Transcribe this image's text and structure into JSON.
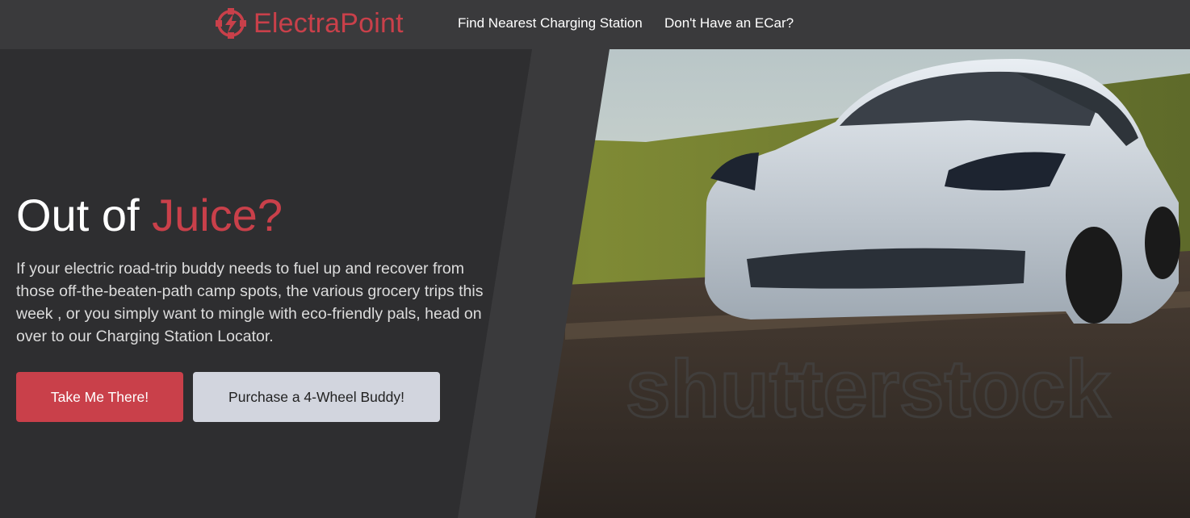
{
  "brand": {
    "name": "ElectraPoint",
    "color": "#c9404a",
    "icon": "lightning-bolt-icon"
  },
  "nav": {
    "links": [
      {
        "label": "Find Nearest Charging Station"
      },
      {
        "label": "Don't Have an ECar?"
      }
    ]
  },
  "hero": {
    "headline_plain": "Out of ",
    "headline_accent": "Juice?",
    "body": "If your electric road-trip buddy needs to fuel up and recover from those off-the-beaten-path camp spots, the various grocery trips this week , or you simply want to mingle with eco-friendly pals, head on over to our Charging Station Locator.",
    "primary_button": "Take Me There!",
    "secondary_button": "Purchase a 4-Wheel Buddy!",
    "image_watermark": "shutterstock"
  },
  "colors": {
    "accent": "#c9404a",
    "panel": "#2e2e30",
    "nav_bg": "#3a3a3c",
    "secondary_button_bg": "#d2d5de"
  }
}
